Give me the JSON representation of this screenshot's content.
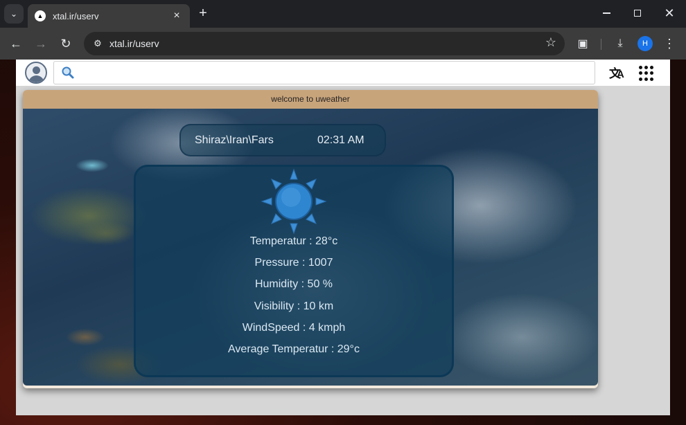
{
  "browser": {
    "tab_title": "xtal.ir/userv",
    "url": "xtal.ir/userv",
    "profile_initial": "H"
  },
  "site": {
    "search_placeholder": "",
    "banner": "welcome to uweather",
    "location": "Shiraz\\Iran\\Fars",
    "time": "02:31 AM",
    "stats": {
      "temperature": "Temperatur : 28°c",
      "pressure": "Pressure : 1007",
      "humidity": "Humidity : 50 %",
      "visibility": "Visibility : 10 km",
      "windspeed": "WindSpeed : 4 kmph",
      "avg_temperature": "Average Temperatur : 29°c"
    }
  },
  "icons": {
    "weather": "sun-icon",
    "accent": "#1a73e8",
    "banner_color": "#c8a47b"
  }
}
